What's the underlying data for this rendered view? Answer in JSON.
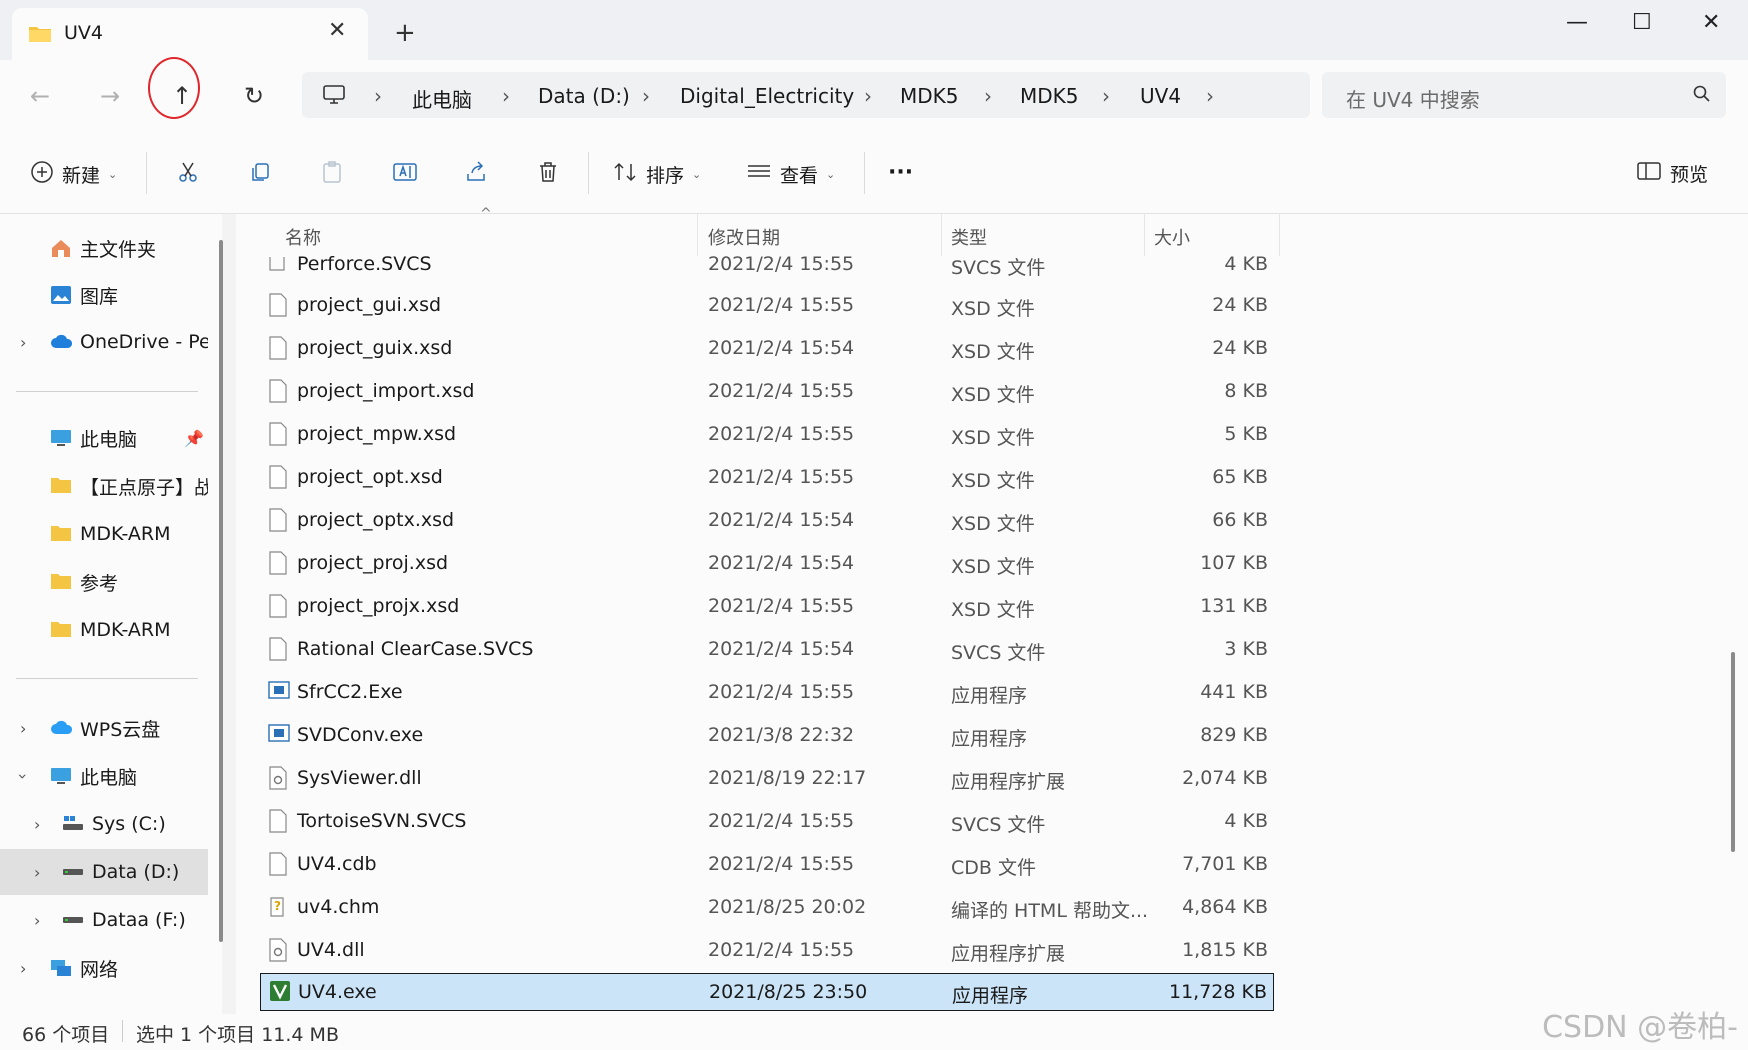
{
  "window": {
    "tab_title": "UV4",
    "tab_close": "✕",
    "new_tab": "+",
    "minimize": "—",
    "maximize": "☐",
    "close": "✕"
  },
  "nav": {
    "back": "←",
    "forward": "→",
    "up": "↑",
    "refresh": "↻"
  },
  "breadcrumb": [
    "此电脑",
    "Data (D:)",
    "Digital_Electricity",
    "MDK5",
    "MDK5",
    "UV4"
  ],
  "breadcrumb_sep": "›",
  "search": {
    "placeholder": "在 UV4 中搜索"
  },
  "toolbar": {
    "new_label": "新建",
    "sort_label": "排序",
    "view_label": "查看",
    "more_label": "···",
    "preview_label": "预览",
    "caret": "⌄"
  },
  "sidebar": {
    "home": "主文件夹",
    "gallery": "图库",
    "onedrive": "OneDrive - Per",
    "thispc_pinned": "此电脑",
    "pinned_folder1": "【正点原子】战",
    "pinned_folder2": "MDK-ARM",
    "pinned_folder3": "参考",
    "pinned_folder4": "MDK-ARM",
    "wps": "WPS云盘",
    "thispc": "此电脑",
    "drive_c": "Sys (C:)",
    "drive_d": "Data (D:)",
    "drive_f": "Dataa (F:)",
    "network": "网络"
  },
  "columns": {
    "name": "名称",
    "date": "修改日期",
    "type": "类型",
    "size": "大小"
  },
  "files": [
    {
      "name": "Perforce.SVCS",
      "date": "2021/2/4 15:55",
      "type": "SVCS 文件",
      "size": "4 KB"
    },
    {
      "name": "project_gui.xsd",
      "date": "2021/2/4 15:55",
      "type": "XSD 文件",
      "size": "24 KB"
    },
    {
      "name": "project_guix.xsd",
      "date": "2021/2/4 15:54",
      "type": "XSD 文件",
      "size": "24 KB"
    },
    {
      "name": "project_import.xsd",
      "date": "2021/2/4 15:55",
      "type": "XSD 文件",
      "size": "8 KB"
    },
    {
      "name": "project_mpw.xsd",
      "date": "2021/2/4 15:55",
      "type": "XSD 文件",
      "size": "5 KB"
    },
    {
      "name": "project_opt.xsd",
      "date": "2021/2/4 15:55",
      "type": "XSD 文件",
      "size": "65 KB"
    },
    {
      "name": "project_optx.xsd",
      "date": "2021/2/4 15:54",
      "type": "XSD 文件",
      "size": "66 KB"
    },
    {
      "name": "project_proj.xsd",
      "date": "2021/2/4 15:54",
      "type": "XSD 文件",
      "size": "107 KB"
    },
    {
      "name": "project_projx.xsd",
      "date": "2021/2/4 15:55",
      "type": "XSD 文件",
      "size": "131 KB"
    },
    {
      "name": "Rational ClearCase.SVCS",
      "date": "2021/2/4 15:54",
      "type": "SVCS 文件",
      "size": "3 KB"
    },
    {
      "name": "SfrCC2.Exe",
      "date": "2021/2/4 15:55",
      "type": "应用程序",
      "size": "441 KB"
    },
    {
      "name": "SVDConv.exe",
      "date": "2021/3/8 22:32",
      "type": "应用程序",
      "size": "829 KB"
    },
    {
      "name": "SysViewer.dll",
      "date": "2021/8/19 22:17",
      "type": "应用程序扩展",
      "size": "2,074 KB"
    },
    {
      "name": "TortoiseSVN.SVCS",
      "date": "2021/2/4 15:55",
      "type": "SVCS 文件",
      "size": "4 KB"
    },
    {
      "name": "UV4.cdb",
      "date": "2021/2/4 15:55",
      "type": "CDB 文件",
      "size": "7,701 KB"
    },
    {
      "name": "uv4.chm",
      "date": "2021/8/25 20:02",
      "type": "编译的 HTML 帮助文...",
      "size": "4,864 KB"
    },
    {
      "name": "UV4.dll",
      "date": "2021/2/4 15:55",
      "type": "应用程序扩展",
      "size": "1,815 KB"
    },
    {
      "name": "UV4.exe",
      "date": "2021/8/25 23:50",
      "type": "应用程序",
      "size": "11,728 KB"
    }
  ],
  "status": {
    "count": "66 个项目",
    "selection": "选中 1 个项目  11.4 MB"
  },
  "watermark": "CSDN @卷柏-",
  "colors": {
    "accent": "#0067c0",
    "selection": "#cce4f7",
    "annotation": "#e0262b"
  }
}
